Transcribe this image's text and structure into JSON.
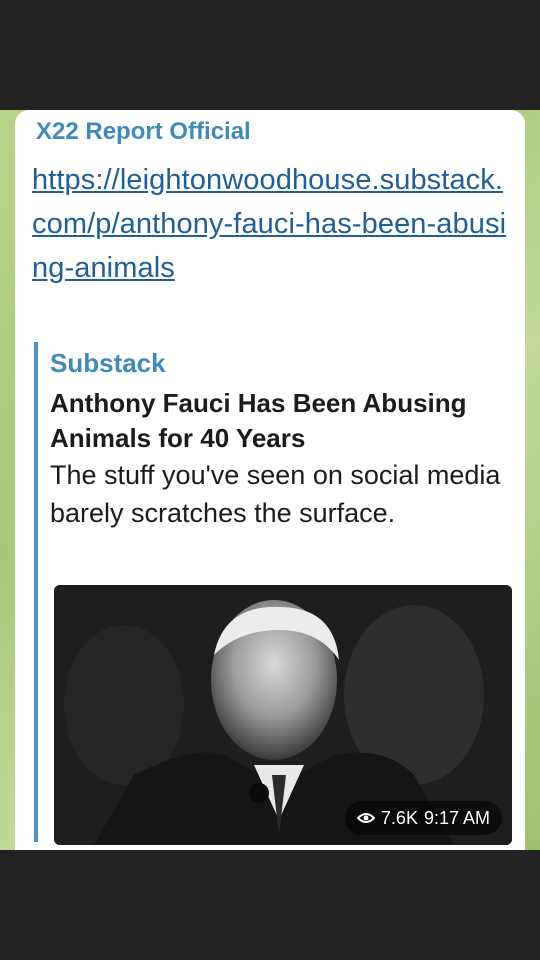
{
  "message": {
    "sender": "X22 Report Official",
    "link": "https://leightonwoodhouse.substack.com/p/anthony-fauci-has-been-abusing-animals"
  },
  "preview": {
    "site": "Substack",
    "title": "Anthony Fauci Has Been Abusing Animals for 40 Years",
    "description": "The stuff you've seen on social media barely scratches the surface."
  },
  "meta": {
    "views": "7.6K",
    "time": "9:17 AM"
  },
  "colors": {
    "sender": "#3f8ab8",
    "link": "#1f5f95",
    "accent_bar": "#4a92c9",
    "background_top": "#232323",
    "chat_background": "#a8c97a"
  }
}
